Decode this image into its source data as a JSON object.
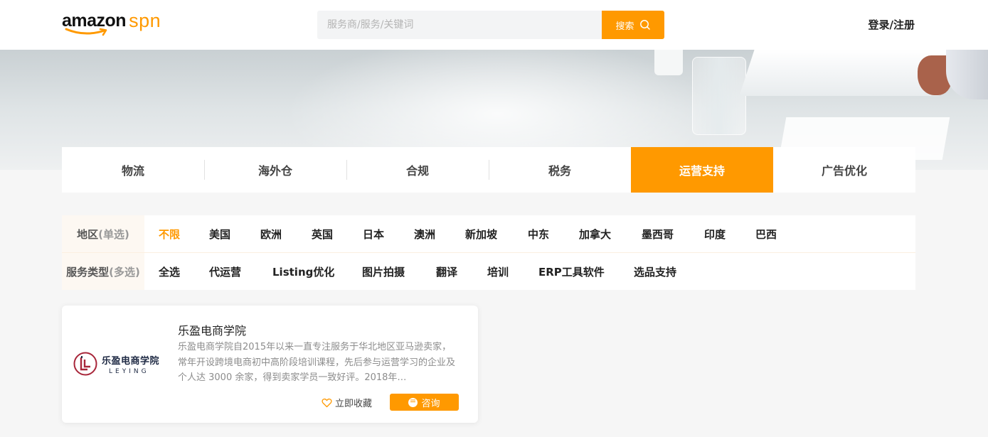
{
  "header": {
    "logo_main": "amazon",
    "logo_sub": "spn",
    "search_placeholder": "服务商/服务/关键词",
    "search_button": "搜索",
    "login": "登录/注册"
  },
  "categories": [
    {
      "label": "物流",
      "active": false
    },
    {
      "label": "海外仓",
      "active": false
    },
    {
      "label": "合规",
      "active": false
    },
    {
      "label": "税务",
      "active": false
    },
    {
      "label": "运营支持",
      "active": true
    },
    {
      "label": "广告优化",
      "active": false
    }
  ],
  "filters": {
    "region": {
      "label": "地区",
      "hint": "(单选)",
      "options": [
        "不限",
        "美国",
        "欧洲",
        "英国",
        "日本",
        "澳洲",
        "新加坡",
        "中东",
        "加拿大",
        "墨西哥",
        "印度",
        "巴西"
      ],
      "selected": "不限"
    },
    "service": {
      "label": "服务类型",
      "hint": "(多选)",
      "options": [
        "全选",
        "代运营",
        "Listing优化",
        "图片拍摄",
        "翻译",
        "培训",
        "ERP工具软件",
        "选品支持"
      ]
    }
  },
  "providers": [
    {
      "logo_cn": "乐盈电商学院",
      "logo_en": "LEYING",
      "name": "乐盈电商学院",
      "description": "乐盈电商学院自2015年以来一直专注服务于华北地区亚马逊卖家，常年开设跨境电商初中高阶段培训课程，先后参与运营学习的企业及个人达 3000 余家，得到卖家学员一致好评。2018年…",
      "favorite_label": "立即收藏",
      "consult_label": "咨询"
    }
  ],
  "colors": {
    "accent": "#ff9900",
    "brand_dark": "#111111",
    "logo_red": "#a8263a"
  }
}
